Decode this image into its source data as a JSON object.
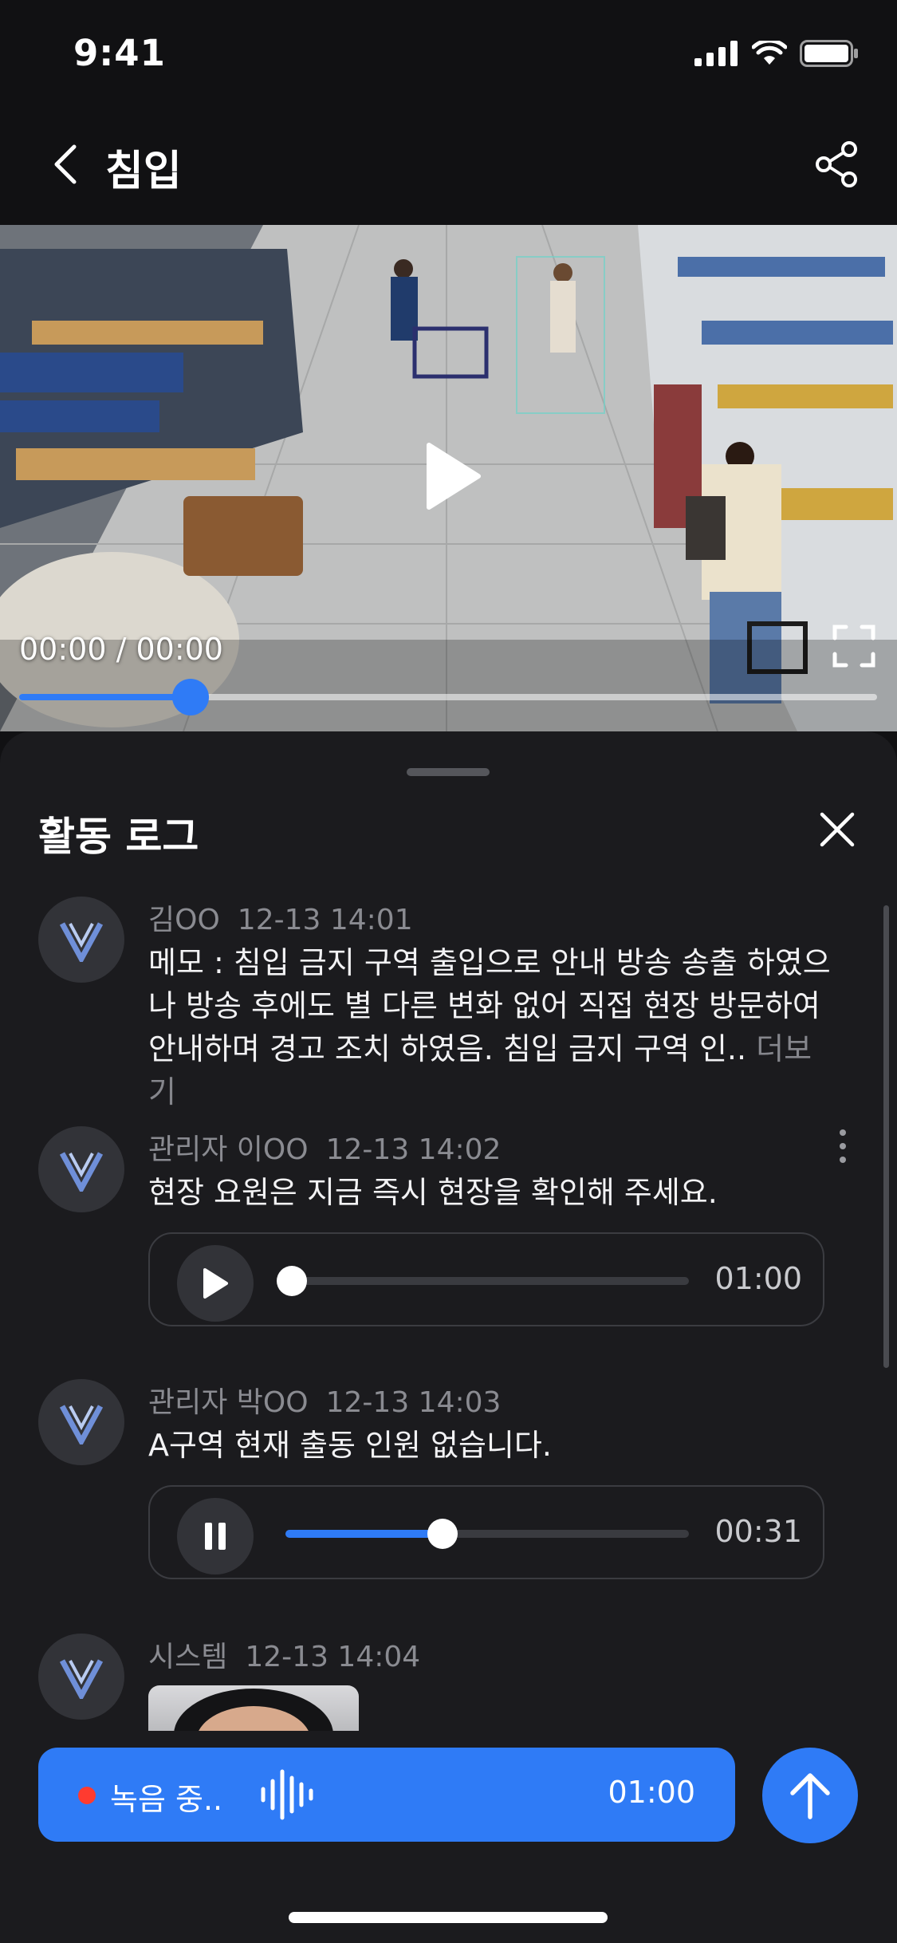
{
  "status": {
    "time": "9:41"
  },
  "nav": {
    "title": "침입"
  },
  "video": {
    "time_display": "00:00 / 00:00",
    "progress": 0.2
  },
  "sheet": {
    "title": "활동 로그"
  },
  "logs": [
    {
      "author": "김OO",
      "timestamp": "12-13 14:01",
      "message": "메모 : 침입 금지 구역 출입으로 안내 방송 송출 하였으나 방송 후에도 별 다른 변화 없어 직접 현장 방문하여 안내하며 경고 조치 하였음. 침입 금지 구역 인..",
      "more_label": "더보기"
    },
    {
      "author": "관리자 이OO",
      "timestamp": "12-13 14:02",
      "message": "현장 요원은 지금 즉시 현장을 확인해 주세요.",
      "audio": {
        "state": "paused",
        "progress": 0.0,
        "duration": "01:00"
      }
    },
    {
      "author": "관리자 박OO",
      "timestamp": "12-13 14:03",
      "message": "A구역 현재 출동 인원 없습니다.",
      "audio": {
        "state": "playing",
        "progress": 0.38,
        "duration": "00:31"
      }
    },
    {
      "author": "시스템",
      "timestamp": "12-13 14:04"
    }
  ],
  "recorder": {
    "label": "녹음 중..",
    "time": "01:00"
  },
  "colors": {
    "accent": "#2f7bf6",
    "background": "#1b1b1e",
    "record_dot": "#ff3b30"
  }
}
